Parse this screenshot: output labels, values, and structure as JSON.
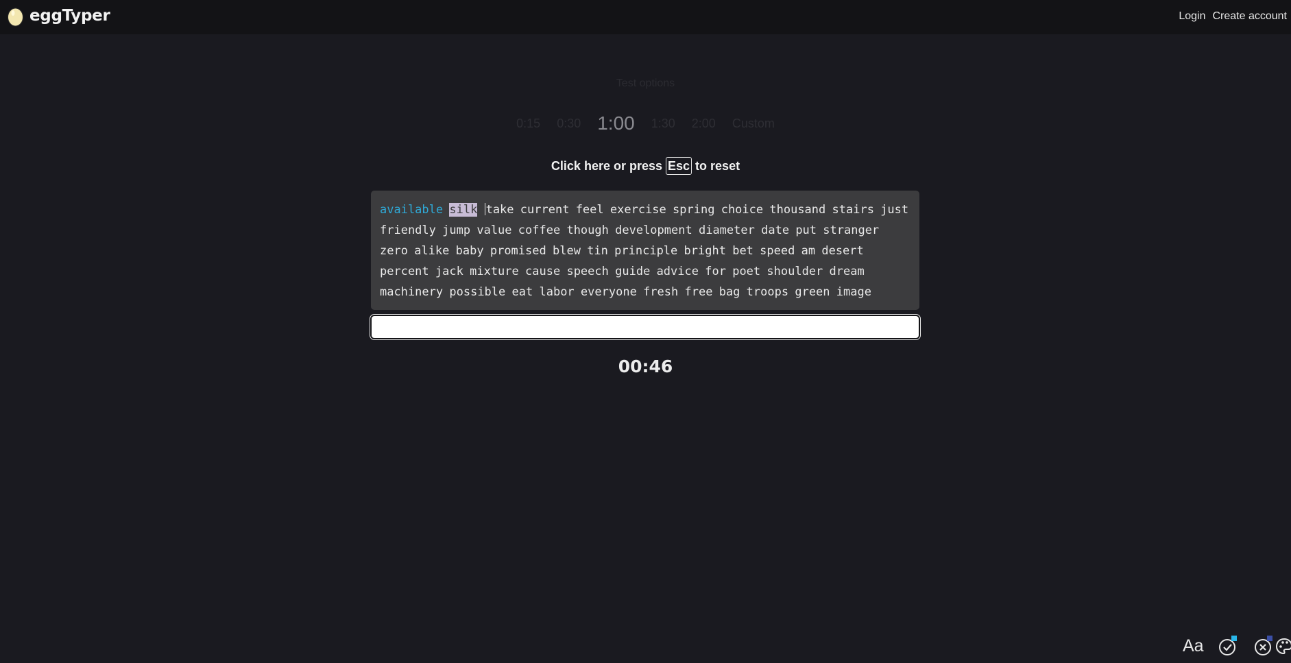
{
  "app": {
    "name": "eggTyper",
    "logo_icon": "egg-icon"
  },
  "nav": {
    "login": "Login",
    "create_account": "Create account"
  },
  "test_options": {
    "title": "Test options",
    "times": [
      "0:15",
      "0:30",
      "1:00",
      "1:30",
      "2:00",
      "Custom"
    ],
    "selected": "1:00"
  },
  "reset_hint": {
    "before": "Click here or press",
    "key": "Esc",
    "after": "to reset"
  },
  "words": {
    "completed": [
      "available"
    ],
    "current": "silk",
    "upcoming": [
      "take",
      "current",
      "feel",
      "exercise",
      "spring",
      "choice",
      "thousand",
      "stairs",
      "just",
      "friendly",
      "jump",
      "value",
      "coffee",
      "though",
      "development",
      "diameter",
      "date",
      "put",
      "stranger",
      "zero",
      "alike",
      "baby",
      "promised",
      "blew",
      "tin",
      "principle",
      "bright",
      "bet",
      "speed",
      "am",
      "desert",
      "percent",
      "jack",
      "mixture",
      "cause",
      "speech",
      "guide",
      "advice",
      "for",
      "poet",
      "shoulder",
      "dream",
      "machinery",
      "possible",
      "eat",
      "labor",
      "everyone",
      "fresh",
      "free",
      "bag",
      "troops",
      "green",
      "image"
    ]
  },
  "input": {
    "value": "",
    "placeholder": ""
  },
  "timer": "00:46",
  "bottom_icons": {
    "font": {
      "label": "Aa",
      "icon": "font-icon"
    },
    "correct": {
      "icon": "check-circle-icon",
      "badge_color": "#29b6e8"
    },
    "incorrect": {
      "icon": "x-circle-icon",
      "badge_color": "#3b4fa6"
    },
    "theme": {
      "icon": "palette-icon"
    }
  },
  "colors": {
    "background": "#1a1a20",
    "topbar": "#131316",
    "completed_word": "#2fa9d6",
    "current_word_highlight": "#c8bcd6",
    "words_panel": "#3c3c3e"
  }
}
